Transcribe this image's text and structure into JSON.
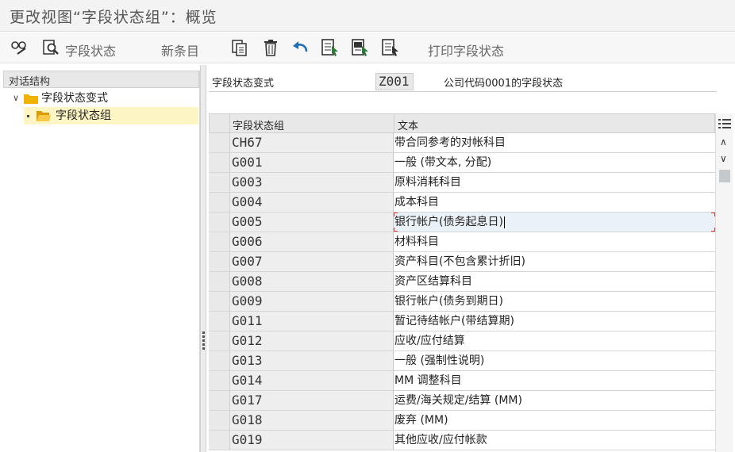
{
  "window": {
    "title": "更改视图“字段状态组”：概览"
  },
  "toolbar": {
    "field_status_label": "字段状态",
    "new_entries_label": "新条目",
    "print_field_status_label": "打印字段状态"
  },
  "left_pane": {
    "header": "对话结构",
    "tree": [
      {
        "label": "字段状态变式"
      },
      {
        "label": "字段状态组"
      }
    ]
  },
  "variant": {
    "label": "字段状态变式",
    "value": "Z001",
    "description": "公司代码0001的字段状态"
  },
  "table": {
    "columns": [
      "字段状态组",
      "文本"
    ],
    "rows": [
      {
        "group": "CH67",
        "text": "带合同参考的对帐科目"
      },
      {
        "group": "G001",
        "text": "一般 (带文本, 分配)"
      },
      {
        "group": "G003",
        "text": "原料消耗科目"
      },
      {
        "group": "G004",
        "text": "成本科目"
      },
      {
        "group": "G005",
        "text": "银行帐户(债务起息日)"
      },
      {
        "group": "G006",
        "text": "材料科目"
      },
      {
        "group": "G007",
        "text": "资产科目(不包含累计折旧)"
      },
      {
        "group": "G008",
        "text": "资产区结算科目"
      },
      {
        "group": "G009",
        "text": "银行帐户(债务到期日)"
      },
      {
        "group": "G011",
        "text": "暂记待结帐户(带结算期)"
      },
      {
        "group": "G012",
        "text": "应收/应付结算"
      },
      {
        "group": "G013",
        "text": "一般 (强制性说明)"
      },
      {
        "group": "G014",
        "text": "MM 调整科目"
      },
      {
        "group": "G017",
        "text": "运费/海关规定/结算 (MM)"
      },
      {
        "group": "G018",
        "text": "废弃 (MM)"
      },
      {
        "group": "G019",
        "text": "其他应收/应付帐款"
      }
    ]
  },
  "colors": {
    "folder": "#f0b400",
    "tree_selected_bg": "#fdf6c4",
    "active_row_bg": "#eaf2f8",
    "focus_marker": "#dd3333",
    "icon_blue": "#1f6fb5",
    "icon_green": "#2c7a3c"
  },
  "icons": {
    "toolbar": [
      "glasses-pencil-icon",
      "search-doc-icon",
      "copy-icon",
      "delete-icon",
      "undo-icon",
      "select-all-icon",
      "select-block-icon",
      "deselect-icon"
    ],
    "table": [
      "column-settings-icon",
      "scroll-up-icon",
      "scroll-down-icon"
    ]
  }
}
